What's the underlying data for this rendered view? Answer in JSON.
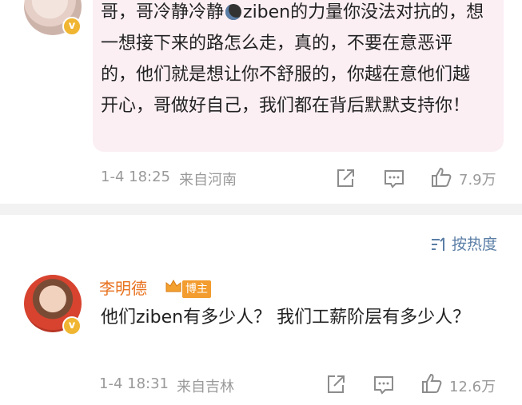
{
  "comment1": {
    "text_prefix": "哥，哥冷静冷静",
    "text_rest": "ziben的力量你没法对抗的，想一想接下来的路怎么走，真的，不要在意恶评的，他们就是想让你不舒服的，你越在意他们越开心，哥做好自己，我们都在背后默默支持你！",
    "time": "1-4 18:25",
    "location": "来自河南",
    "likes": "7.9万"
  },
  "sort": {
    "label": "按热度"
  },
  "comment2": {
    "author": "李明德",
    "badge": "博主",
    "text": "他们ziben有多少人？ 我们工薪阶层有多少人？",
    "time": "1-4 18:31",
    "location": "来自吉林",
    "likes": "12.6万"
  },
  "icons": [
    "share-icon",
    "comment-icon",
    "like-icon",
    "sort-icon",
    "crown-icon",
    "verified-icon"
  ],
  "colors": {
    "bubble": "#fbeff4",
    "author": "#e8711e",
    "sort": "#5a7ea6",
    "meta": "#9a9a9a",
    "badge": "#f39c2f"
  }
}
